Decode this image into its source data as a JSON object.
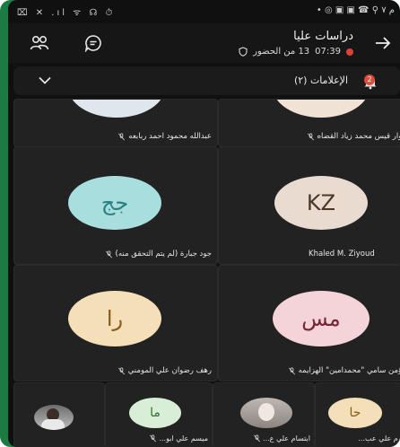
{
  "status_bar": {
    "left_text": "⌧ ✕ .ıl ᯤ ☊ ⏱",
    "right_text": "م ٧ ⚲ ☎ ▣ ▣ ◎ •"
  },
  "meeting": {
    "title": "دراسات عليا",
    "time": "07:39",
    "attendees": "13 من الحضور"
  },
  "notifications": {
    "label": "الإعلامات (٢)",
    "count": "2"
  },
  "colors": {
    "accent_red": "#e0403c",
    "tile_bg": "#222222",
    "frame_green": "#1c7a43"
  },
  "participants": {
    "row1": [
      {
        "name": "عبدالله محمود احمد ربابعه"
      },
      {
        "name": "نوار قيس محمد زياد القضاه"
      }
    ],
    "row2": [
      {
        "initials": "جج",
        "name": "جود  جبارة (لم يتم التحقق منه)",
        "avatar_bg": "#a8dede",
        "text_color": "#2a7f7f"
      },
      {
        "initials": "KZ",
        "name": "Khaled M. Ziyoud",
        "avatar_bg": "#eadbd0",
        "text_color": "#4a3728"
      }
    ],
    "row3": [
      {
        "initials": "را",
        "name": "رهف رضوان علي المومني",
        "avatar_bg": "#f5dfb8",
        "text_color": "#8a5a12"
      },
      {
        "initials": "مس",
        "name": "مؤمن سامي \"محمدامين\" الهزايمه",
        "avatar_bg": "#f4d4d8",
        "text_color": "#7a2434"
      }
    ],
    "row4": [
      {
        "name": ""
      },
      {
        "initials": "ما",
        "name": "ميسم علي ابو...",
        "avatar_bg": "#d8eed6",
        "text_color": "#2f6f33"
      },
      {
        "name": "ابتسام علي ع..."
      },
      {
        "initials": "حا",
        "name": "حازم علي عب...",
        "avatar_bg": "#f5dfb8",
        "text_color": "#8a5a12"
      }
    ]
  }
}
